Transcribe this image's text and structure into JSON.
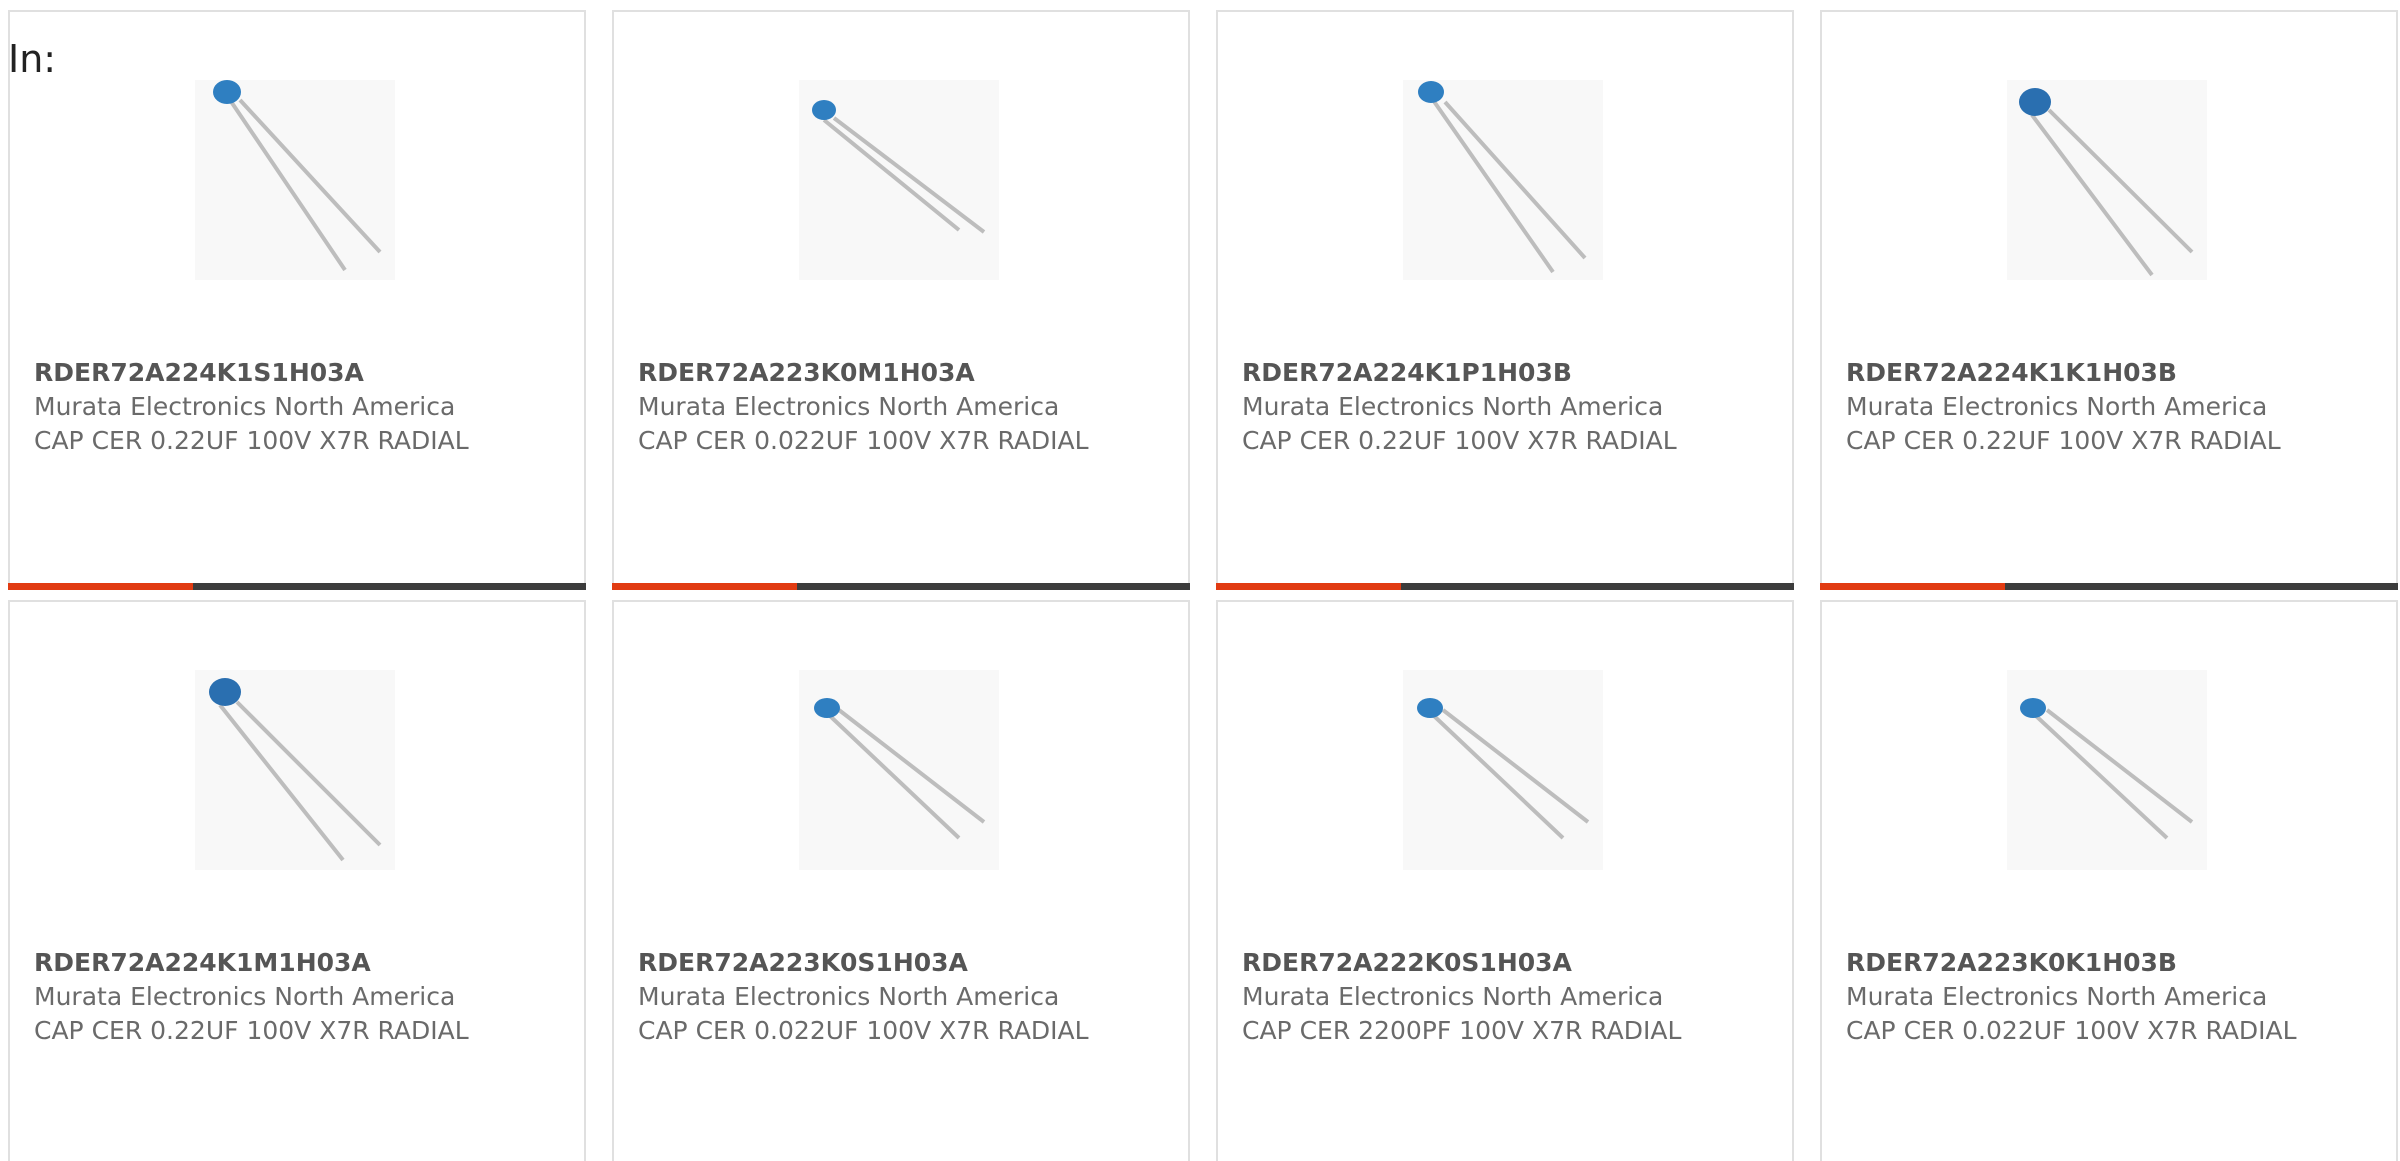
{
  "header": {
    "label": "In:"
  },
  "colors": {
    "accent": "#e13b12",
    "track": "#3c3c3c",
    "capacitor_body": "#2f7fc1",
    "lead": "#bdbdbd"
  },
  "cards": [
    {
      "part_number": "RDER72A224K1S1H03A",
      "manufacturer": "Murata Electronics North America",
      "description": "CAP CER 0.22UF 100V X7R RADIAL",
      "image_icon": "ceramic-capacitor-image",
      "progress_fraction": 0.32
    },
    {
      "part_number": "RDER72A223K0M1H03A",
      "manufacturer": "Murata Electronics North America",
      "description": "CAP CER 0.022UF 100V X7R RADIAL",
      "image_icon": "ceramic-capacitor-image",
      "progress_fraction": 0.32
    },
    {
      "part_number": "RDER72A224K1P1H03B",
      "manufacturer": "Murata Electronics North America",
      "description": "CAP CER 0.22UF 100V X7R RADIAL",
      "image_icon": "ceramic-capacitor-image",
      "progress_fraction": 0.32
    },
    {
      "part_number": "RDER72A224K1K1H03B",
      "manufacturer": "Murata Electronics North America",
      "description": "CAP CER 0.22UF 100V X7R RADIAL",
      "image_icon": "ceramic-capacitor-image",
      "progress_fraction": 0.32
    },
    {
      "part_number": "RDER72A224K1M1H03A",
      "manufacturer": "Murata Electronics North America",
      "description": "CAP CER 0.22UF 100V X7R RADIAL",
      "image_icon": "ceramic-capacitor-image",
      "progress_fraction": null
    },
    {
      "part_number": "RDER72A223K0S1H03A",
      "manufacturer": "Murata Electronics North America",
      "description": "CAP CER 0.022UF 100V X7R RADIAL",
      "image_icon": "ceramic-capacitor-image",
      "progress_fraction": null
    },
    {
      "part_number": "RDER72A222K0S1H03A",
      "manufacturer": "Murata Electronics North America",
      "description": "CAP CER 2200PF 100V X7R RADIAL",
      "image_icon": "ceramic-capacitor-image",
      "progress_fraction": null
    },
    {
      "part_number": "RDER72A223K0K1H03B",
      "manufacturer": "Murata Electronics North America",
      "description": "CAP CER 0.022UF 100V X7R RADIAL",
      "image_icon": "ceramic-capacitor-image",
      "progress_fraction": null
    }
  ]
}
